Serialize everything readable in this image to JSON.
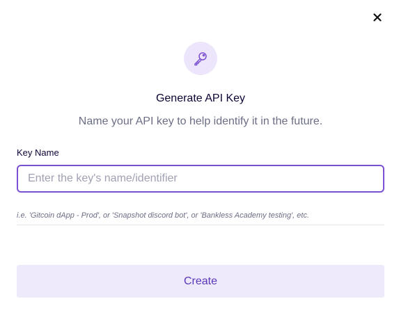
{
  "modal": {
    "icon": "key-icon",
    "close_icon": "close-icon",
    "title": "Generate API Key",
    "subtitle": "Name your API key to help identify it in the future.",
    "field": {
      "label": "Key Name",
      "value": "",
      "placeholder": "Enter the key's name/identifier"
    },
    "hint": "i.e. 'Gitcoin dApp - Prod', or 'Snapshot discord bot', or 'Bankless Academy testing', etc.",
    "create_label": "Create"
  },
  "colors": {
    "accent": "#7b4fd1",
    "icon_bg": "#ede5fb",
    "button_bg": "#efe9fc",
    "button_text": "#5a37b8",
    "title_text": "#0e0333",
    "muted_text": "#6b6e85"
  }
}
